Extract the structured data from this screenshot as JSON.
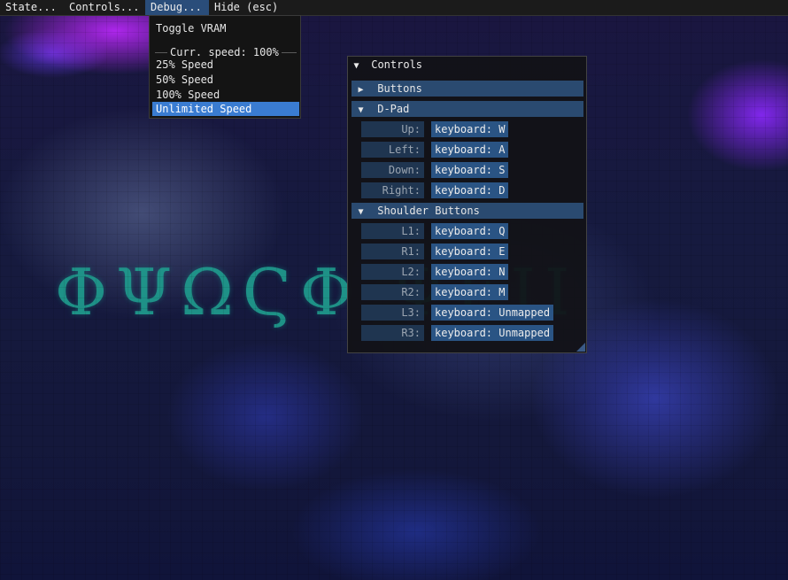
{
  "menubar": {
    "items": [
      "State...",
      "Controls...",
      "Debug...",
      "Hide (esc)"
    ]
  },
  "debug_menu": {
    "toggle_vram": "Toggle VRAM",
    "speed_separator": "Curr. speed: 100%",
    "speeds": [
      "25% Speed",
      "50% Speed",
      "100% Speed",
      "Unlimited Speed"
    ],
    "selected": "Unlimited Speed"
  },
  "controls_window": {
    "title": "Controls",
    "sections": {
      "buttons": {
        "label": "Buttons",
        "expanded": false
      },
      "dpad": {
        "label": "D-Pad",
        "expanded": true,
        "rows": [
          {
            "label": "Up:",
            "value": "keyboard: W"
          },
          {
            "label": "Left:",
            "value": "keyboard: A"
          },
          {
            "label": "Down:",
            "value": "keyboard: S"
          },
          {
            "label": "Right:",
            "value": "keyboard: D"
          }
        ]
      },
      "shoulder": {
        "label": "Shoulder Buttons",
        "expanded": true,
        "rows": [
          {
            "label": "L1:",
            "value": "keyboard: Q"
          },
          {
            "label": "R1:",
            "value": "keyboard: E"
          },
          {
            "label": "L2:",
            "value": "keyboard: N"
          },
          {
            "label": "R2:",
            "value": "keyboard: M"
          },
          {
            "label": "L3:",
            "value": "keyboard: Unmapped"
          },
          {
            "label": "R3:",
            "value": "keyboard: Unmapped"
          }
        ]
      }
    }
  },
  "background": {
    "title_glyphs": "ΦΨΩϚΦ  ΨΕΙΙ"
  },
  "colors": {
    "menu_active": "#2a4d7a",
    "selected_item": "#3a7cd1",
    "header": "#2a4a70",
    "value_button": "#2a5484",
    "label_box": "#1f3550"
  }
}
